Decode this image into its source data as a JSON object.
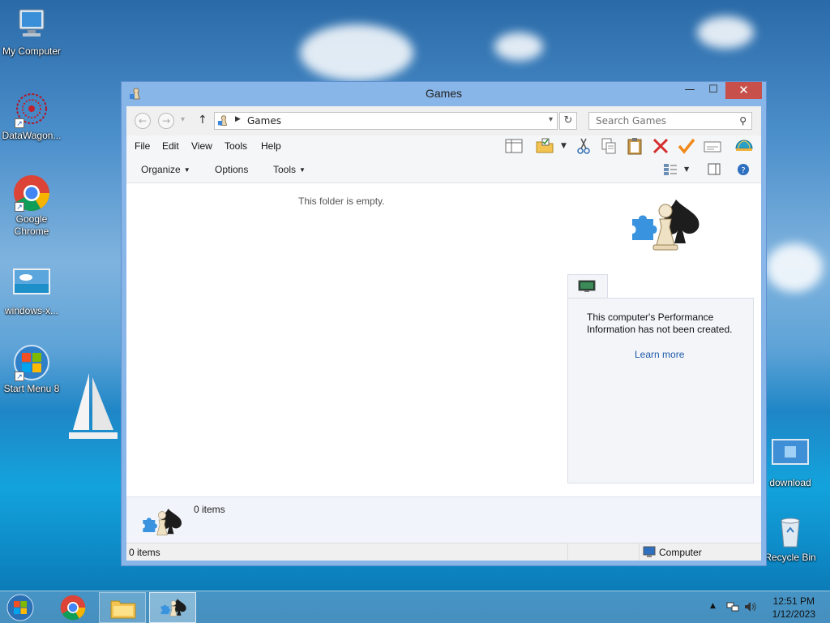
{
  "desktop": {
    "icons": [
      {
        "label": "My Computer"
      },
      {
        "label": "DataWagon..."
      },
      {
        "label": "Google Chrome"
      },
      {
        "label": "windows-x..."
      },
      {
        "label": "Start Menu 8"
      },
      {
        "label": "download"
      },
      {
        "label": "Recycle Bin"
      }
    ]
  },
  "window": {
    "title": "Games",
    "controls": {
      "minimize": "—",
      "maximize": "☐",
      "close": "✕"
    }
  },
  "address_bar": {
    "back": "←",
    "forward": "→",
    "recent": "▾",
    "up": "↑",
    "separator": "▶",
    "path": "Games",
    "dropdown": "▾",
    "refresh": "↻",
    "search_placeholder": "Search Games"
  },
  "menubar": {
    "items": [
      "File",
      "Edit",
      "View",
      "Tools",
      "Help"
    ]
  },
  "commandbar": {
    "organize": "Organize",
    "options": "Options",
    "tools": "Tools"
  },
  "content": {
    "empty_message": "This folder is empty.",
    "panel_text": "This computer's Performance Information has not been created.",
    "learn_more": "Learn more"
  },
  "details": {
    "count": "0 items"
  },
  "statusbar": {
    "left": "0 items",
    "right": "Computer"
  },
  "taskbar": {
    "time": "12:51 PM",
    "date": "1/12/2023"
  },
  "colors": {
    "close_button": "#c7504a",
    "window_frame": "#89b6e8",
    "link": "#1e5aa8"
  }
}
